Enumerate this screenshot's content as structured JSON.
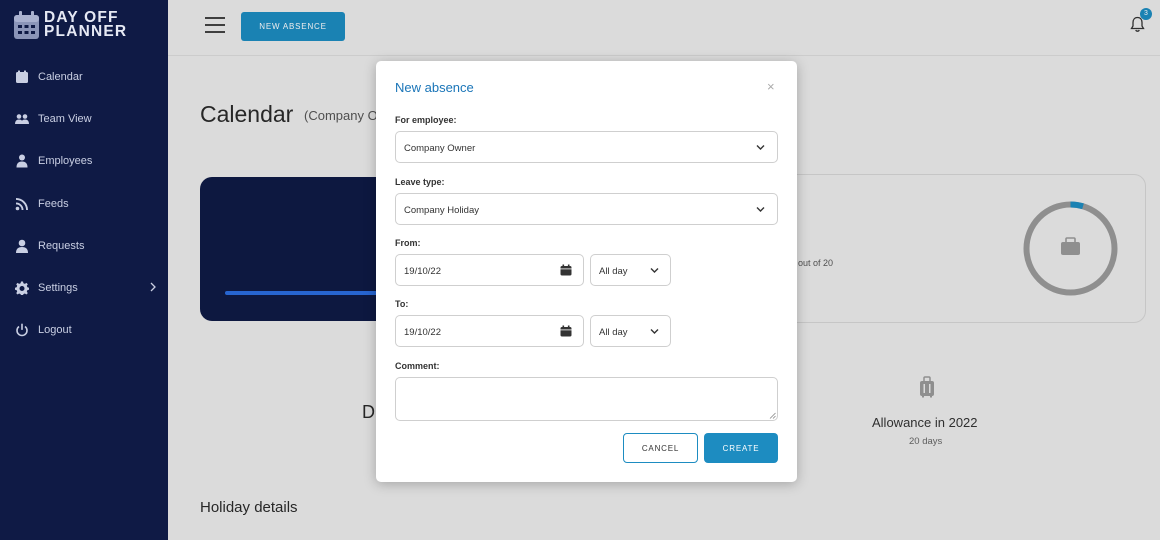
{
  "brand": {
    "line1": "DAY OFF",
    "line2": "PLANNER"
  },
  "sidebar": {
    "items": [
      {
        "label": "Calendar",
        "icon": "calendar-icon"
      },
      {
        "label": "Team View",
        "icon": "team-icon"
      },
      {
        "label": "Employees",
        "icon": "employees-icon"
      },
      {
        "label": "Feeds",
        "icon": "rss-icon"
      },
      {
        "label": "Requests",
        "icon": "user-icon"
      },
      {
        "label": "Settings",
        "icon": "gear-icon"
      },
      {
        "label": "Logout",
        "icon": "power-icon"
      }
    ]
  },
  "topbar": {
    "new_absence_label": "NEW ABSENCE",
    "notification_count": "3"
  },
  "page": {
    "title": "Calendar",
    "subtitle": "(Company O",
    "stat_text": "out of 20",
    "letter": "D",
    "allowance_title": "Allowance in 2022",
    "allowance_sub": "20 days",
    "holiday_details": "Holiday details"
  },
  "modal": {
    "title": "New absence",
    "close": "×",
    "employee_label": "For employee:",
    "employee_value": "Company Owner",
    "leave_type_label": "Leave type:",
    "leave_type_value": "Company Holiday",
    "from_label": "From:",
    "from_date": "19/10/22",
    "from_day": "All day",
    "to_label": "To:",
    "to_date": "19/10/22",
    "to_day": "All day",
    "comment_label": "Comment:",
    "comment_value": "",
    "cancel_label": "CANCEL",
    "create_label": "CREATE"
  },
  "colors": {
    "sidebar_bg": "#0f1a45",
    "accent": "#1d8cc1",
    "title_blue": "#1a75b8"
  }
}
